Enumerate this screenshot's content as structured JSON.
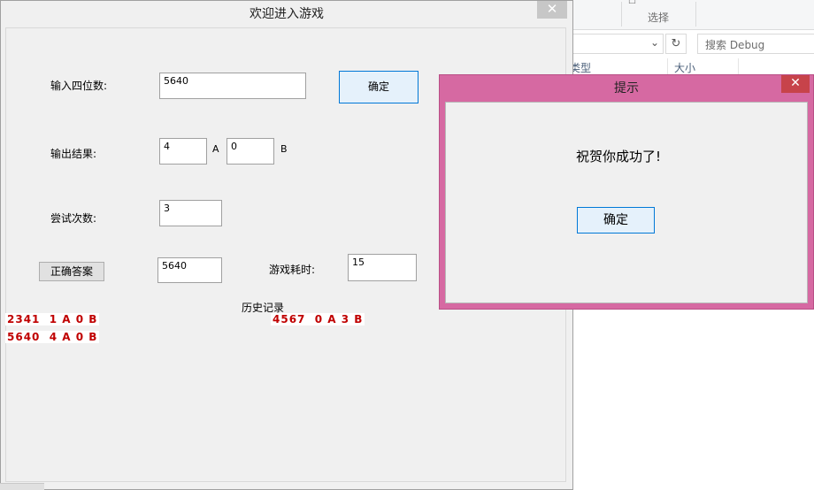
{
  "explorer": {
    "ribbon_glyph": "☐",
    "ribbon_select_label": "选择",
    "search_placeholder": "搜索 Debug",
    "refresh_glyph": "↻",
    "chevron_glyph": "⌄",
    "columns": [
      "类型",
      "大小"
    ]
  },
  "main_window": {
    "title": "欢迎进入游戏",
    "close_glyph": "✕",
    "input_label": "输入四位数:",
    "input_value": "5640",
    "confirm_label": "确定",
    "output_label": "输出结果:",
    "result_a_value": "4",
    "result_a_unit": "A",
    "result_b_value": "0",
    "result_b_unit": "B",
    "attempts_label": "尝试次数:",
    "attempts_value": "3",
    "answer_button_label": "正确答案",
    "answer_value": "5640",
    "time_label": "游戏耗时:",
    "time_value": "15",
    "history_title": "历史记录",
    "history": [
      "2341  1 A 0 B",
      "5640  4 A 0 B",
      "4567  0 A 3 B"
    ]
  },
  "message_box": {
    "title": "提示",
    "close_glyph": "✕",
    "message": "祝贺你成功了!",
    "ok_label": "确定"
  },
  "colors": {
    "history_text": "#c00000",
    "message_frame": "#d669a2",
    "message_close": "#c7434a"
  }
}
